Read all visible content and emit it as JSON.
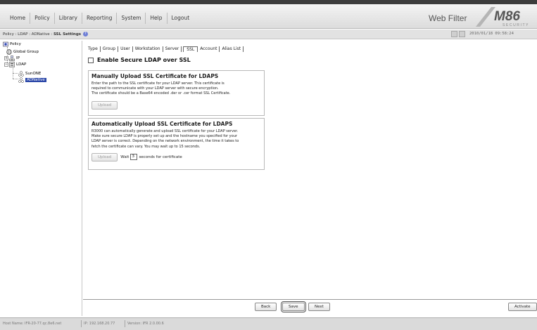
{
  "nav": {
    "items": [
      "Home",
      "Policy",
      "Library",
      "Reporting",
      "System",
      "Help",
      "Logout"
    ]
  },
  "product": {
    "title": "Web Filter",
    "logo_text": "M86",
    "logo_subtext": "SECURITY"
  },
  "breadcrumb": {
    "path": "Policy : LDAP : ADNative : ",
    "page": "SSL Settings"
  },
  "datetime": "2010/01/18 09:58:24",
  "tree": {
    "root": "Policy",
    "global_group": "Global Group",
    "ip": "IP",
    "ldap": "LDAP",
    "servers": [
      "SunONE",
      "ADNative"
    ],
    "selected": "ADNative"
  },
  "tabs": [
    "Type",
    "Group",
    "User",
    "Workstation",
    "Server",
    "SSL",
    "Account",
    "Alias List"
  ],
  "active_tab": "SSL",
  "enable_ssl": {
    "label": "Enable Secure LDAP over SSL",
    "checked": false
  },
  "manual": {
    "title": "Manually Upload SSL Certificate for LDAPS",
    "lines": [
      "Enter the path to the SSL certificate for your LDAP server. This certificate is",
      "required to communicate with your LDAP server with secure encryption.",
      "The certificate should be a Base64 encoded .der or .cer format SSL Certificate."
    ],
    "upload_label": "Upload"
  },
  "auto": {
    "title": "Automatically Upload SSL Certificate for LDAPS",
    "lines": [
      "R3000 can automatically generate and upload SSL certificate for your LDAP server.",
      "Make sure secure LDAP is properly set up and the hostname you specified for your",
      "LDAP server is correct. Depending on the network environment, the time it takes to",
      "fetch the certificate can vary. You may wait up to 15 seconds."
    ],
    "upload_label": "Upload",
    "wait_label": "Wait",
    "wait_value": "3",
    "seconds_label": "seconds for certificate"
  },
  "footer": {
    "back": "Back",
    "save": "Save",
    "next": "Next",
    "activate": "Activate"
  },
  "status": {
    "host": "Host Name: IFR-20-77.qc.8e6.net",
    "ip": "IP: 192.168.20.77",
    "version": "Version: IFR 2.0.00.6"
  },
  "colors": {
    "selection": "#2b47a8",
    "logo": "#555555",
    "help_icon": "#6f7fd6"
  }
}
